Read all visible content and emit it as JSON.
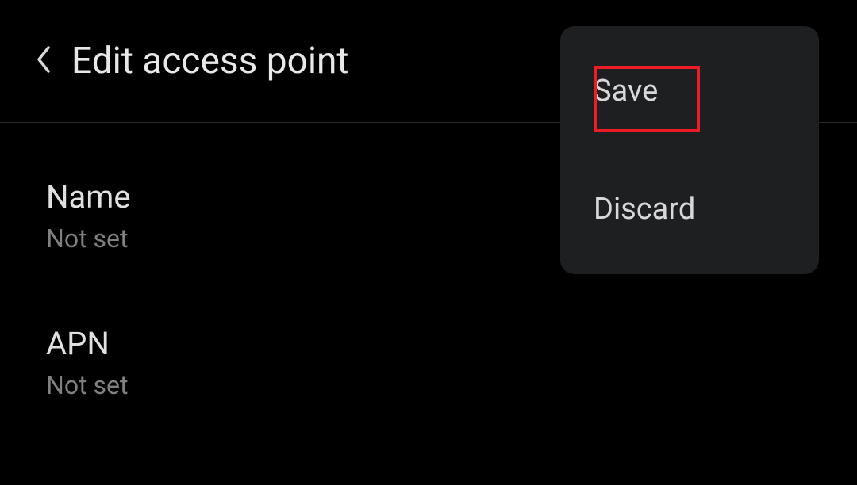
{
  "header": {
    "title": "Edit access point"
  },
  "settings": {
    "name": {
      "label": "Name",
      "value": "Not set"
    },
    "apn": {
      "label": "APN",
      "value": "Not set"
    }
  },
  "menu": {
    "save_label": "Save",
    "discard_label": "Discard"
  }
}
